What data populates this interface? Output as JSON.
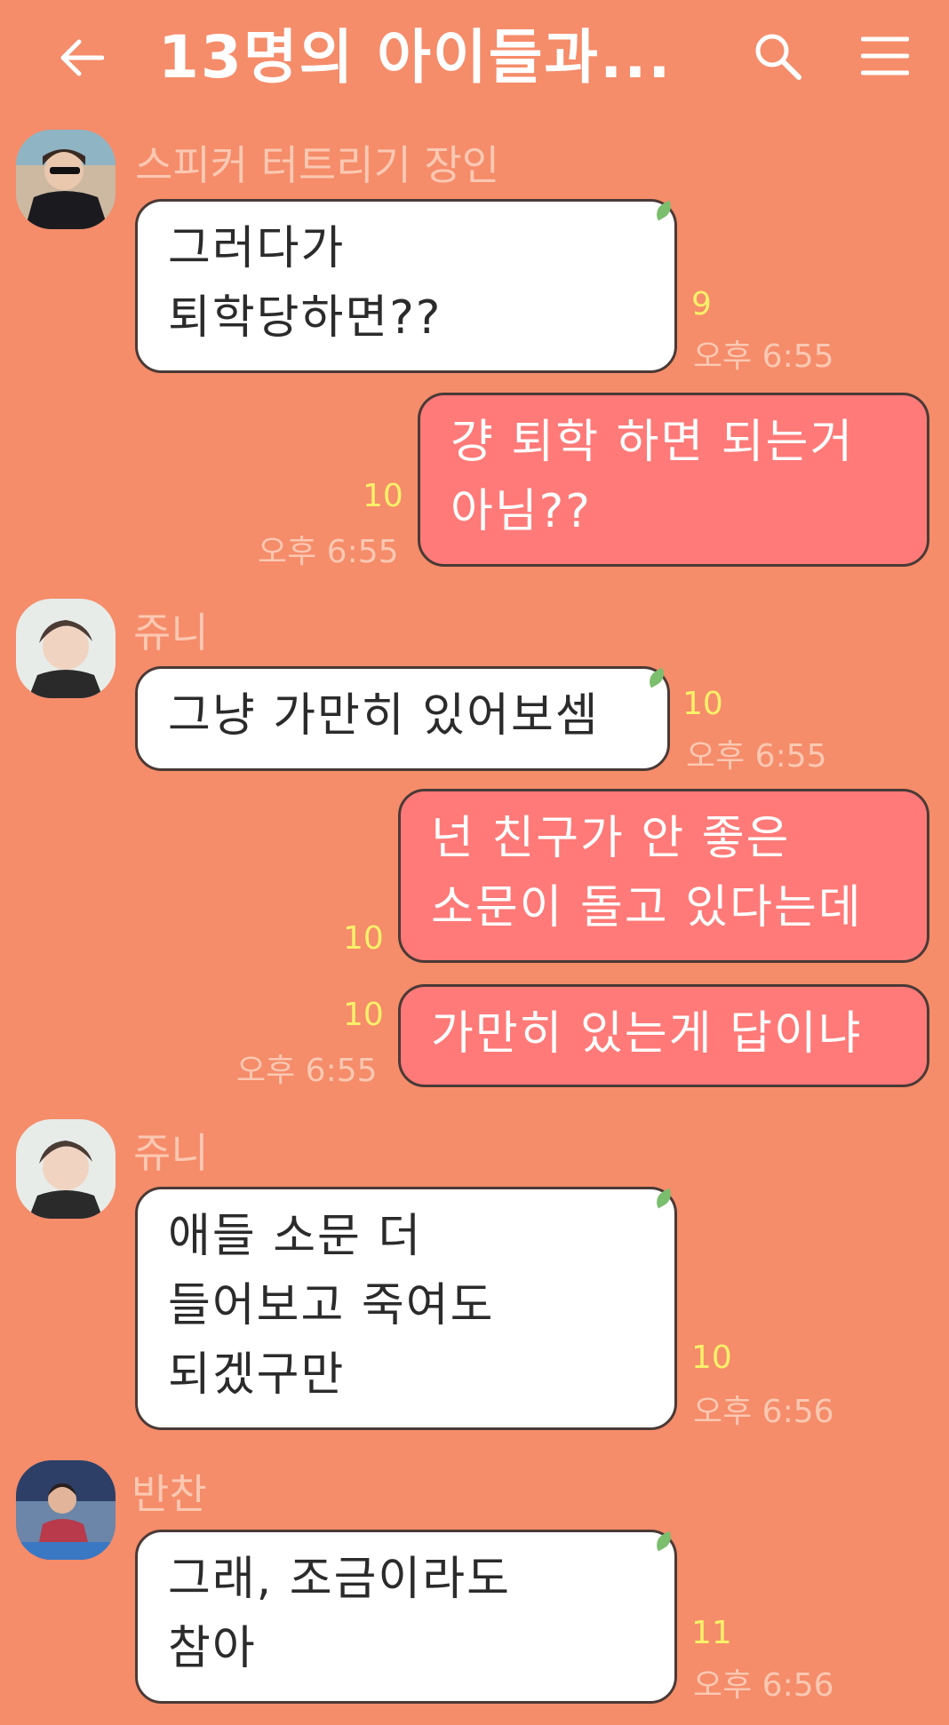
{
  "header": {
    "title": "13명의 아이들과...",
    "back_icon": "back-arrow-icon",
    "search_icon": "search-icon",
    "menu_icon": "hamburger-menu-icon"
  },
  "colors": {
    "background": "#F58C6A",
    "outgoing_bubble": "#FF7A78",
    "incoming_bubble": "#FFFFFF",
    "unread_count": "#F9F06A",
    "meta_text": "#FBC8B2"
  },
  "messages": [
    {
      "sender": "스피커 터트리기 장인",
      "text": "그러다가\n퇴학당하면??",
      "read": "9",
      "time": "오후 6:55"
    },
    {
      "text": "걍 퇴학 하면 되는거\n아님??",
      "read": "10",
      "time": "오후 6:55"
    },
    {
      "sender": "쥬니",
      "text": "그냥 가만히 있어보셈",
      "read": "10",
      "time": "오후 6:55"
    },
    {
      "text": "넌 친구가 안 좋은\n소문이 돌고 있다는데",
      "read": "10",
      "time": ""
    },
    {
      "text": "가만히 있는게 답이냐",
      "read": "10",
      "time": "오후 6:55"
    },
    {
      "sender": "쥬니",
      "text": "애들 소문 더\n들어보고 죽여도\n되겠구만",
      "read": "10",
      "time": "오후 6:56"
    },
    {
      "sender": "반찬",
      "text": "그래, 조금이라도\n참아",
      "read": "11",
      "time": "오후 6:56"
    }
  ]
}
